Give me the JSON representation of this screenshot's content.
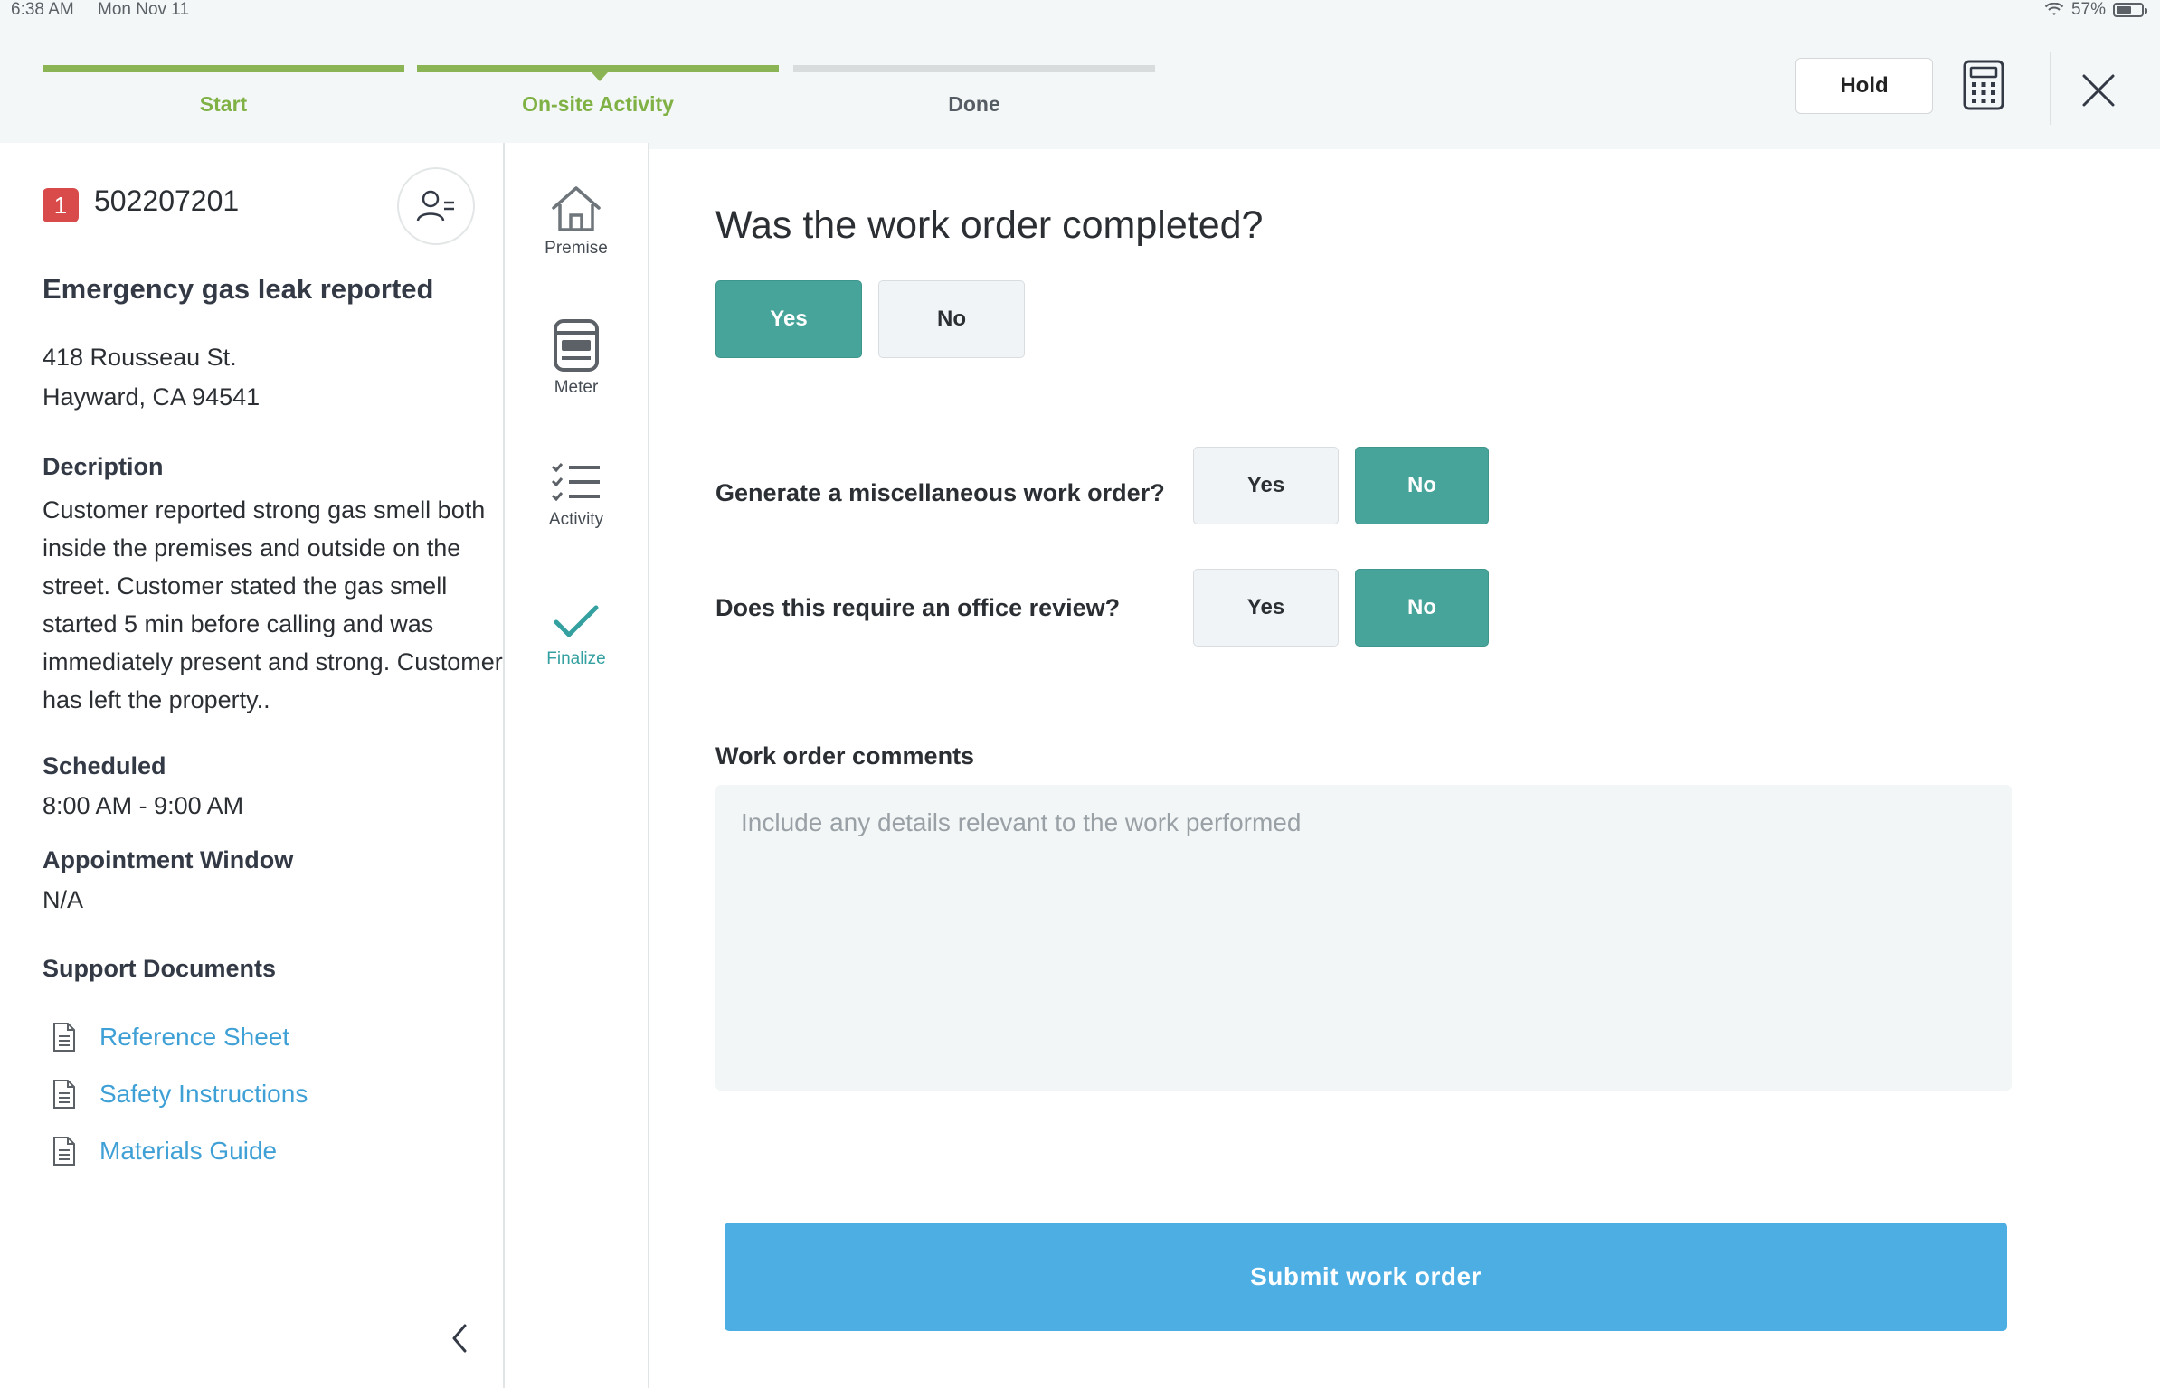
{
  "status_bar": {
    "time": "6:38 AM",
    "date": "Mon Nov 11",
    "battery": "57%"
  },
  "progress": {
    "steps": [
      {
        "label": "Start",
        "state": "complete"
      },
      {
        "label": "On-site Activity",
        "state": "current"
      },
      {
        "label": "Done",
        "state": "pending"
      }
    ]
  },
  "header": {
    "hold_label": "Hold",
    "calculator_icon": "calculator-icon",
    "close_icon": "close-icon"
  },
  "work_order": {
    "priority": "1",
    "number": "502207201",
    "title": "Emergency gas leak reported",
    "address_line1": "418 Rousseau St.",
    "address_line2": "Hayward, CA 94541",
    "description_label": "Decription",
    "description": "Customer reported strong gas smell both inside the premises and outside on the street. Customer stated the gas smell started 5 min before calling and was immediately present and strong. Customer has left the property..",
    "scheduled_label": "Scheduled",
    "scheduled": "8:00 AM - 9:00 AM",
    "appointment_label": "Appointment Window",
    "appointment": "N/A",
    "support_label": "Support Documents",
    "documents": [
      "Reference Sheet",
      "Safety Instructions",
      "Materials Guide"
    ]
  },
  "nav": {
    "items": [
      {
        "label": "Premise",
        "icon": "house-icon"
      },
      {
        "label": "Meter",
        "icon": "meter-icon"
      },
      {
        "label": "Activity",
        "icon": "checklist-icon"
      },
      {
        "label": "Finalize",
        "icon": "check-icon",
        "active": true
      }
    ]
  },
  "form": {
    "completed_question": "Was the work order completed?",
    "completed_yes": "Yes",
    "completed_no": "No",
    "completed_value": "Yes",
    "misc_question": "Generate a miscellaneous work order?",
    "misc_yes": "Yes",
    "misc_no": "No",
    "misc_value": "No",
    "review_question": "Does this require an office review?",
    "review_yes": "Yes",
    "review_no": "No",
    "review_value": "No",
    "comments_label": "Work order comments",
    "comments_placeholder": "Include any details relevant to the work performed",
    "comments_value": "",
    "submit_label": "Submit work order"
  },
  "colors": {
    "accent_teal": "#46a49a",
    "progress_green": "#8bb554",
    "submit_blue": "#4daee4",
    "link_blue": "#3fa0d6",
    "priority_red": "#d94b4b"
  }
}
